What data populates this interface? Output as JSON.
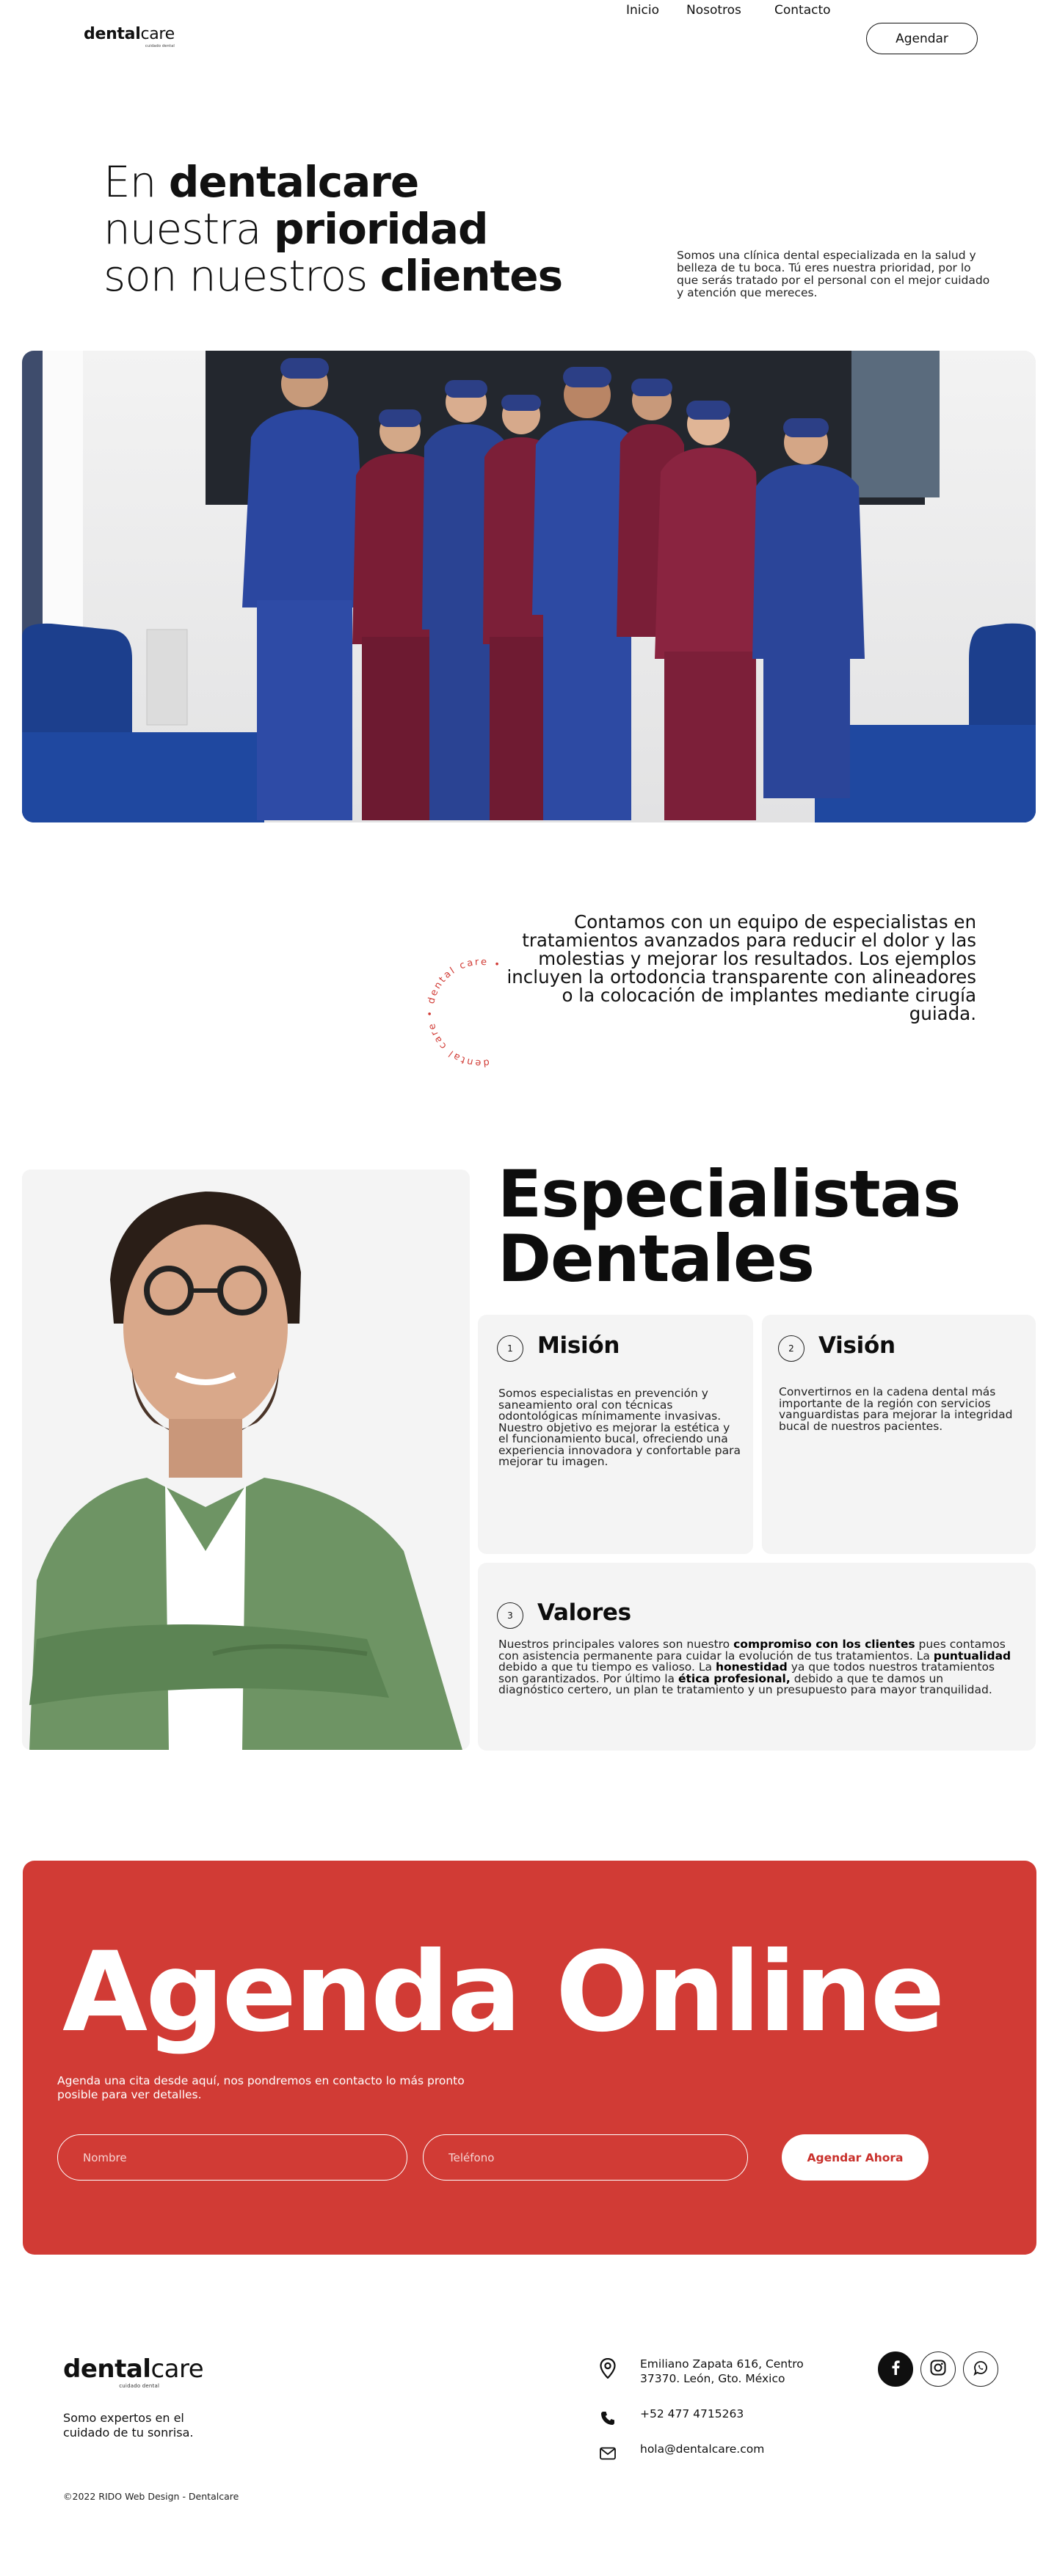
{
  "brand": {
    "name_bold": "dental",
    "name_light": "care",
    "tagline": "cuidado dental"
  },
  "nav": {
    "items": [
      "Inicio",
      "Nosotros",
      "Contacto"
    ],
    "cta": "Agendar"
  },
  "hero": {
    "line1_pre": "En ",
    "line1_bold": "dentalcare",
    "line2_pre": "nuestra ",
    "line2_bold": "prioridad",
    "line3_pre": "son nuestros ",
    "line3_bold": "clientes",
    "description": "Somos una clínica dental especializada en la salud y belleza de tu boca. Tú eres nuestra prioridad, por lo que serás tratado por el personal con el mejor cuidado y atención que mereces."
  },
  "intro": {
    "text": "Contamos con un equipo de especialistas en tratamientos avanzados para reducir el dolor y las molestias y mejorar los resultados. Los ejemplos incluyen la ortodoncia transparente con alineadores o la colocación de implantes mediante cirugía guiada.",
    "badge_text": "dental care • dental care • "
  },
  "specialists": {
    "title_line1": "Especialistas",
    "title_line2": "Dentales",
    "mission": {
      "num": "1",
      "title": "Misión",
      "text": "Somos especialistas en prevención y saneamiento oral con técnicas odontológicas mínimamente invasivas. Nuestro objetivo es mejorar la estética y el funcionamiento bucal, ofreciendo una experiencia innovadora y confortable para mejorar tu imagen."
    },
    "vision": {
      "num": "2",
      "title": "Visión",
      "text": "Convertirnos en la cadena dental más importante de la región con servicios vanguardistas para mejorar la integridad bucal de nuestros pacientes."
    },
    "values": {
      "num": "3",
      "title": "Valores",
      "t1": "Nuestros principales valores son nuestro ",
      "b1": "compromiso con los clientes",
      "t2": " pues contamos con asistencia permanente para cuidar la evolución de tus tratamientos. La ",
      "b2": "puntualidad",
      "t3": " debido a que tu tiempo es valioso. La ",
      "b3": "honestidad",
      "t4": " ya que todos nuestros tratamientos son garantizados. Por último la ",
      "b4": "ética profesional,",
      "t5": " debido a que te damos un diagnóstico certero, un plan te tratamiento y un presupuesto para mayor tranquilidad."
    }
  },
  "agenda": {
    "title": "Agenda Online",
    "description": "Agenda una cita desde aquí, nos pondremos en contacto lo más pronto posible para ver detalles.",
    "name_placeholder": "Nombre",
    "phone_placeholder": "Teléfono",
    "submit": "Agendar Ahora"
  },
  "footer": {
    "tagline": "Somo expertos en el cuidado de tu sonrisa.",
    "address_line1": "Emiliano Zapata 616, Centro",
    "address_line2": "37370. León, Gto. México",
    "phone": "+52 477 4715263",
    "email": "hola@dentalcare.com",
    "copyright": "©2022 RIDO Web Design - Dentalcare",
    "socials": [
      "facebook-icon",
      "instagram-icon",
      "whatsapp-icon"
    ]
  },
  "colors": {
    "accent_red": "#d13b35",
    "text_dark": "#111111",
    "card_gray": "#f4f4f4"
  }
}
